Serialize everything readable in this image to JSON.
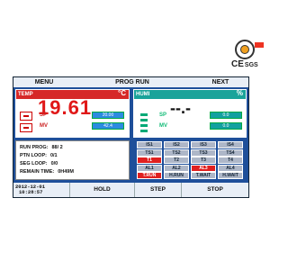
{
  "logos": {
    "ce_mark": "CE",
    "sgs_mark": "SGS",
    "iso_colors": [
      "#f0a020",
      "#e32222"
    ]
  },
  "topbar": {
    "menu": "MENU",
    "prog_run": "PROG RUN",
    "next": "NEXT"
  },
  "temp": {
    "label": "TEMP",
    "unit": "°C",
    "value": "19.61",
    "sp_label": "SP",
    "sp_value": "20.00",
    "mv_label": "MV",
    "mv_value": "42.4"
  },
  "humi": {
    "label": "HUMI",
    "unit": "%",
    "value": "--.-",
    "sp_label": "SP",
    "sp_value": "0.0",
    "mv_label": "MV",
    "mv_value": "0.0"
  },
  "info": {
    "run_prog_label": "RUN PROG:",
    "run_prog_value": "88/ 2",
    "ptn_loop_label": "PTN LOOP:",
    "ptn_loop_value": "0/1",
    "seg_loop_label": "SEG LOOP:",
    "seg_loop_value": "0/0",
    "remain_label": "REMAIN TIME:",
    "remain_value": "0H49M"
  },
  "status_grid": [
    [
      "IS1",
      "IS2",
      "IS3",
      "IS4"
    ],
    [
      "TS1",
      "TS2",
      "TS3",
      "TS4"
    ],
    [
      "T1",
      "T2",
      "T3",
      "T4"
    ],
    [
      "AL1",
      "AL2",
      "AL3",
      "AL4"
    ],
    [
      "T.RUN",
      "H.RUN",
      "T.WAIT",
      "H.WAIT"
    ]
  ],
  "active_cells": [
    "T1",
    "AL3",
    "T.RUN"
  ],
  "bottombar": {
    "date": "2012-12-01",
    "time": "10:28:57",
    "hold": "HOLD",
    "step": "STEP",
    "stop": "STOP"
  },
  "colors": {
    "screen_bg": "#1e4f9a",
    "temp_panel": "#d62828",
    "humi_panel": "#1aa39a",
    "active_red": "#e02020"
  }
}
